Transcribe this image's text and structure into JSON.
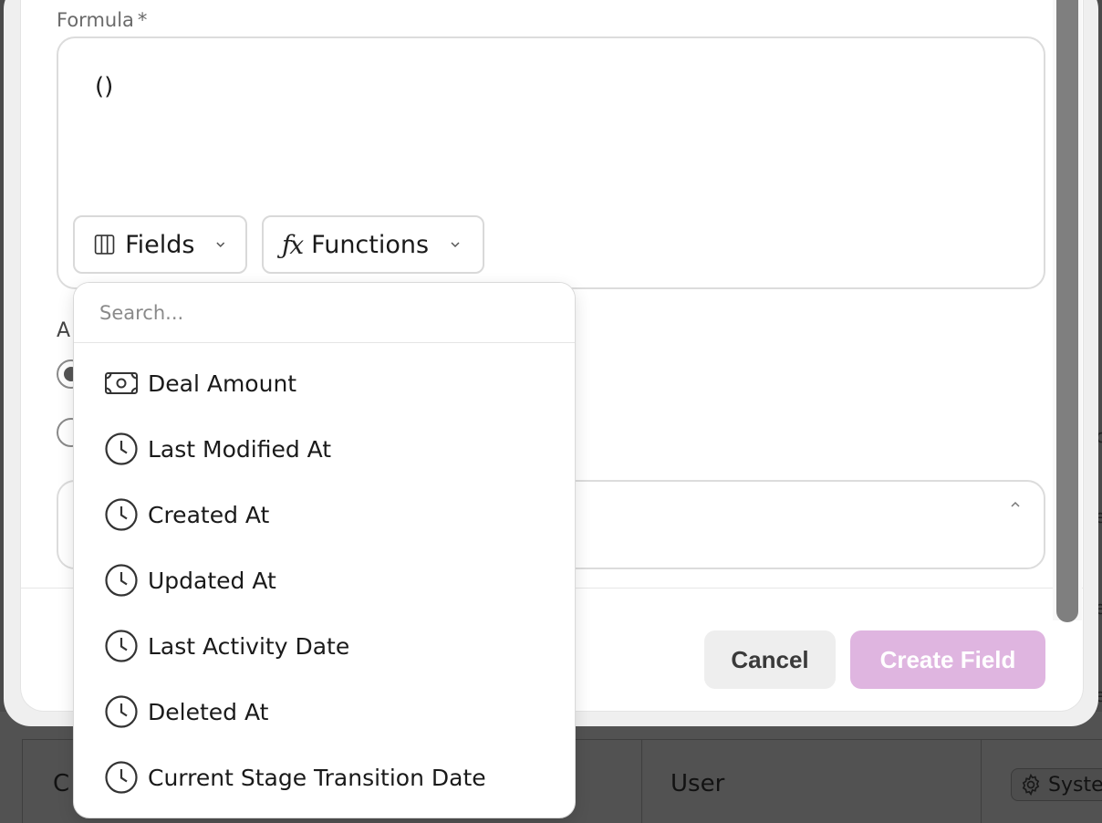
{
  "background": {
    "cells": {
      "c_fragment": "C",
      "user": "User",
      "system": "Syste"
    },
    "right_edge_letters": [
      "c",
      "e",
      "e",
      "e"
    ]
  },
  "formula": {
    "label": "Formula",
    "required_mark": "*",
    "value": "()",
    "fields_button": "Fields",
    "functions_button": "Functions"
  },
  "section": {
    "label_fragment": "A"
  },
  "footer": {
    "cancel": "Cancel",
    "create": "Create Field"
  },
  "dropdown": {
    "search_placeholder": "Search...",
    "items": [
      {
        "label": "Deal Amount",
        "icon": "money-icon"
      },
      {
        "label": "Last Modified At",
        "icon": "clock-icon"
      },
      {
        "label": "Created At",
        "icon": "clock-icon"
      },
      {
        "label": "Updated At",
        "icon": "clock-icon"
      },
      {
        "label": "Last Activity Date",
        "icon": "clock-icon"
      },
      {
        "label": "Deleted At",
        "icon": "clock-icon"
      },
      {
        "label": "Current Stage Transition Date",
        "icon": "clock-icon"
      }
    ]
  },
  "colors": {
    "primary_disabled": "#dfb5e0",
    "overlay": "#4a4a4a"
  }
}
